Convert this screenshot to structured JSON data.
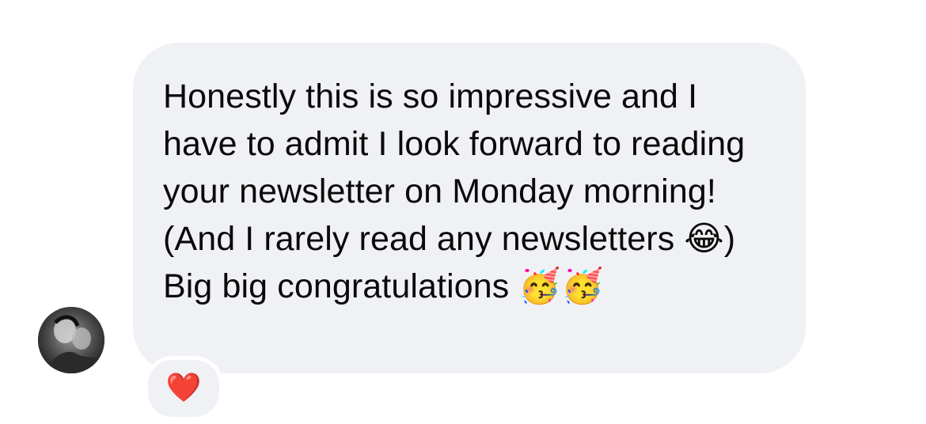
{
  "message": {
    "text": "Honestly this is so impressive and I have to admit I look forward to reading your newsletter on Monday morning! (And I rarely read any newsletters 😂) Big big congratulations 🥳🥳",
    "sender_avatar_icon": "user-avatar-photo",
    "bubble_color": "#f0f1f4",
    "text_color": "#0a0a0a"
  },
  "reaction": {
    "emoji": "❤️",
    "icon": "heart-icon",
    "color": "#e0182d"
  }
}
